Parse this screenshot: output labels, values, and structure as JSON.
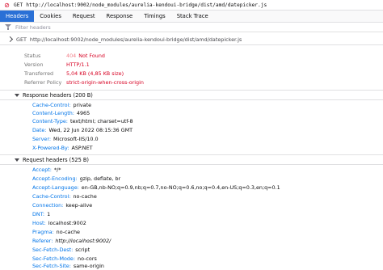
{
  "request": {
    "error_icon": "error-circle-icon",
    "method": "GET",
    "url": "http://localhost:9002/node_modules/aurelia-kendoui-bridge/dist/amd/datepicker.js"
  },
  "tabs": [
    "Headers",
    "Cookies",
    "Request",
    "Response",
    "Timings",
    "Stack Trace"
  ],
  "filter": {
    "placeholder": "Filter headers"
  },
  "summary": {
    "method": "GET",
    "url": "http://localhost:9002/node_modules/aurelia-kendoui-bridge/dist/amd/datepicker.js",
    "status_label": "Status",
    "status_code": "404",
    "status_text": "Not Found",
    "version_label": "Version",
    "version": "HTTP/1.1",
    "transferred_label": "Transferred",
    "transferred": "5,04 KB (4,85 KB size)",
    "referrer_label": "Referrer Policy",
    "referrer": "strict-origin-when-cross-origin"
  },
  "response_headers": {
    "title": "Response headers (200 B)",
    "items": [
      {
        "name": "Cache-Control:",
        "value": "private"
      },
      {
        "name": "Content-Length:",
        "value": "4965"
      },
      {
        "name": "Content-Type:",
        "value": "text/html; charset=utf-8"
      },
      {
        "name": "Date:",
        "value": "Wed, 22 Jun 2022 08:15:36 GMT"
      },
      {
        "name": "Server:",
        "value": "Microsoft-IIS/10.0"
      },
      {
        "name": "X-Powered-By:",
        "value": "ASP.NET"
      }
    ]
  },
  "request_headers": {
    "title": "Request headers (525 B)",
    "items": [
      {
        "name": "Accept:",
        "value": "*/*"
      },
      {
        "name": "Accept-Encoding:",
        "value": "gzip, deflate, br"
      },
      {
        "name": "Accept-Language:",
        "value": "en-GB,nb-NO;q=0.9,nb;q=0.7,no-NO;q=0.6,no;q=0.4,en-US;q=0.3,en;q=0.1"
      },
      {
        "name": "Cache-Control:",
        "value": "no-cache"
      },
      {
        "name": "Connection:",
        "value": "keep-alive"
      },
      {
        "name": "DNT:",
        "value": "1"
      },
      {
        "name": "Host:",
        "value": "localhost:9002"
      },
      {
        "name": "Pragma:",
        "value": "no-cache"
      },
      {
        "name": "Referer:",
        "value": "http://localhost:9002/"
      },
      {
        "name": "Sec-Fetch-Dest:",
        "value": "script"
      },
      {
        "name": "Sec-Fetch-Mode:",
        "value": "no-cors"
      },
      {
        "name": "Sec-Fetch-Site:",
        "value": "same-origin"
      }
    ]
  },
  "colors": {
    "accent": "#2a70d6",
    "header_name": "#0074e8",
    "error": "#d70022"
  }
}
